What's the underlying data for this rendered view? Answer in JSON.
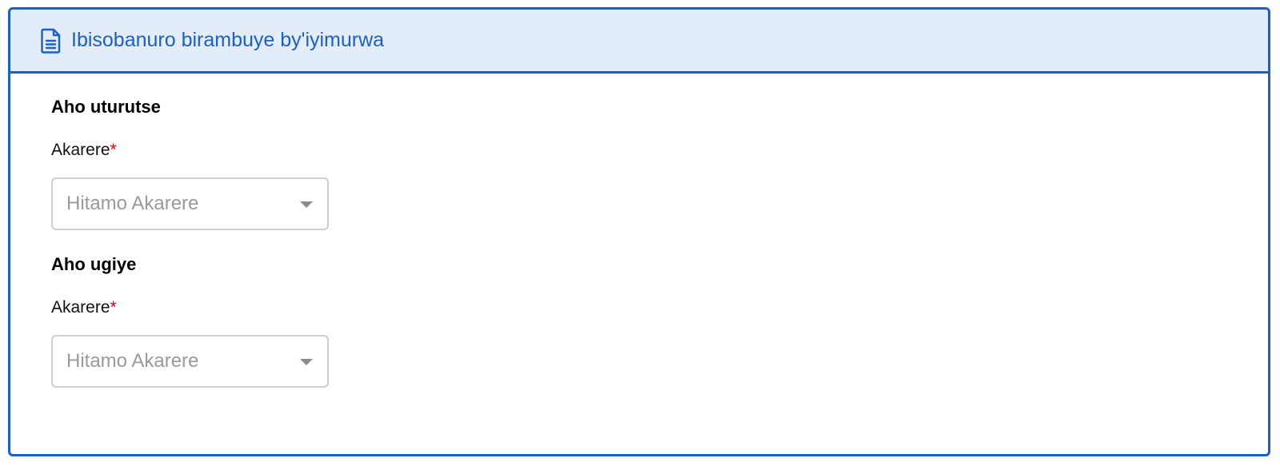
{
  "header": {
    "icon": "document-icon",
    "title": "Ibisobanuro birambuye by'iyimurwa",
    "color": "#1a5fcb",
    "background": "#e2edf9"
  },
  "origin": {
    "section_title": "Aho uturutse",
    "district_label": "Akarere",
    "required_mark": "*",
    "district_placeholder": "Hitamo Akarere"
  },
  "destination": {
    "section_title": "Aho ugiye",
    "district_label": "Akarere",
    "required_mark": "*",
    "district_placeholder": "Hitamo Akarere"
  }
}
